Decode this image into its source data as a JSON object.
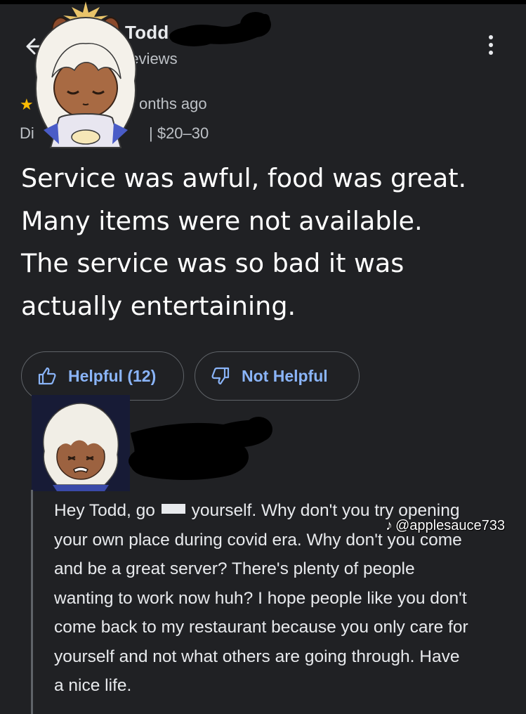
{
  "header": {
    "reviewer_name": "Todd",
    "reviewer_sub": "reviews",
    "time_ago": "onths ago",
    "meta_prefix": "Di",
    "price_range": "| $20–30"
  },
  "review": {
    "lines": [
      "Service was awful, food was great.",
      "Many items were not available.",
      "The service was so bad it was",
      "actually entertaining."
    ]
  },
  "actions": {
    "helpful_label": "Helpful (12)",
    "not_helpful_label": "Not Helpful"
  },
  "owner_reply": {
    "line1_before": "Hey Todd, go",
    "line1_after": "yourself.   Why don't you try opening",
    "lines": [
      "your own place during covid era.  Why don't you come",
      "and be a great server?  There's plenty of people",
      "wanting to work now huh?  I hope people like you don't",
      "come back to my restaurant because you only care for",
      "yourself and not what others are going through.   Have",
      "a nice life."
    ]
  },
  "watermark": {
    "handle": "@applesauce733"
  },
  "colors": {
    "background": "#202124",
    "accent_blue": "#8ab4f8",
    "star": "#fbbc04",
    "scribble": "#000000"
  },
  "icons": [
    "back-arrow-icon",
    "more-vert-icon",
    "star-icon",
    "thumb-up-icon",
    "thumb-down-icon",
    "tiktok-icon"
  ]
}
